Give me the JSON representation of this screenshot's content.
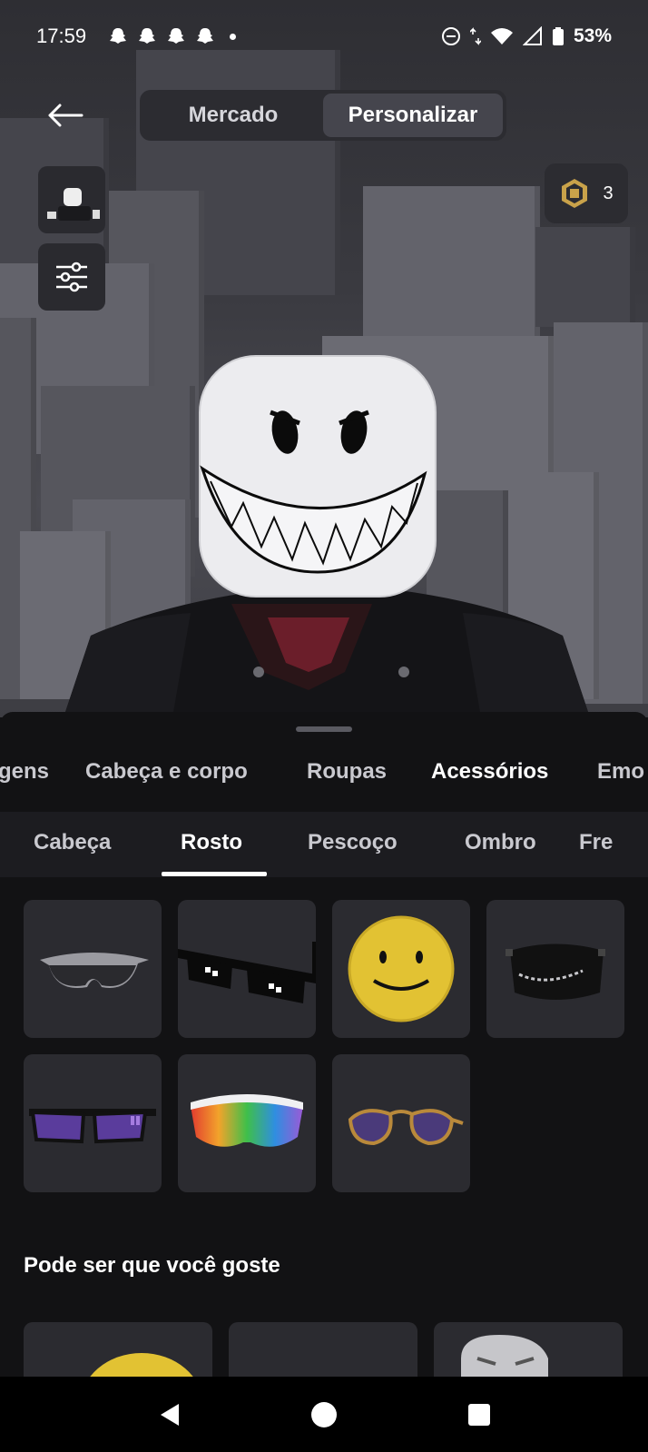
{
  "status_bar": {
    "time": "17:59",
    "notification_icons": [
      "snapchat-icon",
      "snapchat-icon",
      "snapchat-icon",
      "snapchat-icon"
    ],
    "battery": "53%"
  },
  "header": {
    "tabs": [
      {
        "label": "Mercado",
        "active": false
      },
      {
        "label": "Personalizar",
        "active": true
      }
    ],
    "robux_balance": "3"
  },
  "category_tabs": [
    {
      "label": "gens",
      "active": false
    },
    {
      "label": "Cabeça e corpo",
      "active": false
    },
    {
      "label": "Roupas",
      "active": false
    },
    {
      "label": "Acessórios",
      "active": true
    },
    {
      "label": "Emo",
      "active": false
    }
  ],
  "sub_tabs": [
    {
      "label": "Cabeça",
      "active": false
    },
    {
      "label": "Rosto",
      "active": true
    },
    {
      "label": "Pescoço",
      "active": false
    },
    {
      "label": "Ombro",
      "active": false
    },
    {
      "label": "Fre",
      "active": false
    }
  ],
  "items": [
    {
      "name": "black-sport-sunglasses"
    },
    {
      "name": "pixel-deal-with-it-glasses"
    },
    {
      "name": "yellow-smiley-face"
    },
    {
      "name": "black-chain-mask"
    },
    {
      "name": "purple-lens-sunglasses"
    },
    {
      "name": "rainbow-sport-visor"
    },
    {
      "name": "gold-aviator-sunglasses"
    }
  ],
  "recommendations": {
    "title": "Pode ser que você goste"
  },
  "colors": {
    "background": "#121214",
    "tile": "#2b2b30",
    "active_tab_bg": "#45454d"
  }
}
